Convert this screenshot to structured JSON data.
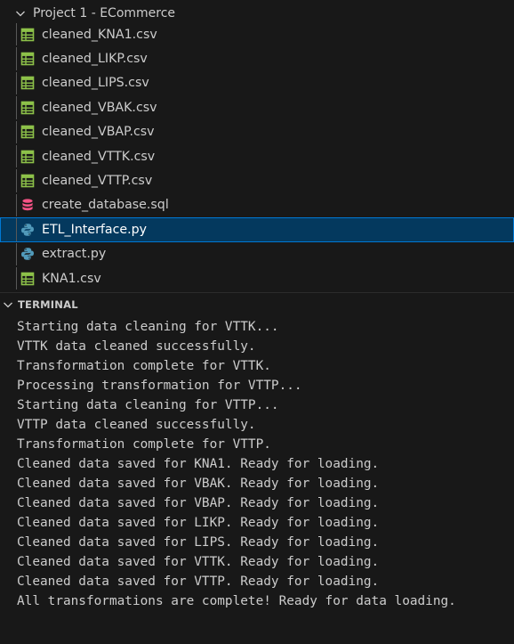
{
  "explorer": {
    "project_title": "Project 1 - ECommerce",
    "files": [
      {
        "name": "cleaned_KNA1.csv",
        "icon": "csv-icon",
        "selected": false
      },
      {
        "name": "cleaned_LIKP.csv",
        "icon": "csv-icon",
        "selected": false
      },
      {
        "name": "cleaned_LIPS.csv",
        "icon": "csv-icon",
        "selected": false
      },
      {
        "name": "cleaned_VBAK.csv",
        "icon": "csv-icon",
        "selected": false
      },
      {
        "name": "cleaned_VBAP.csv",
        "icon": "csv-icon",
        "selected": false
      },
      {
        "name": "cleaned_VTTK.csv",
        "icon": "csv-icon",
        "selected": false
      },
      {
        "name": "cleaned_VTTP.csv",
        "icon": "csv-icon",
        "selected": false
      },
      {
        "name": "create_database.sql",
        "icon": "database-icon",
        "selected": false
      },
      {
        "name": "ETL_Interface.py",
        "icon": "python-icon",
        "selected": true
      },
      {
        "name": "extract.py",
        "icon": "python-icon",
        "selected": false
      },
      {
        "name": "KNA1.csv",
        "icon": "csv-icon",
        "selected": false
      }
    ]
  },
  "terminal": {
    "title": "TERMINAL",
    "lines": [
      "Starting data cleaning for VTTK...",
      "VTTK data cleaned successfully.",
      "Transformation complete for VTTK.",
      "Processing transformation for VTTP...",
      "Starting data cleaning for VTTP...",
      "VTTP data cleaned successfully.",
      "Transformation complete for VTTP.",
      "Cleaned data saved for KNA1. Ready for loading.",
      "Cleaned data saved for VBAK. Ready for loading.",
      "Cleaned data saved for VBAP. Ready for loading.",
      "Cleaned data saved for LIKP. Ready for loading.",
      "Cleaned data saved for LIPS. Ready for loading.",
      "Cleaned data saved for VTTK. Ready for loading.",
      "Cleaned data saved for VTTP. Ready for loading.",
      "All transformations are complete! Ready for data loading."
    ]
  },
  "colors": {
    "background": "#181818",
    "text": "#cccccc",
    "selection_bg": "#04395e",
    "selection_border": "#0078d4",
    "csv_icon": "#8dc149",
    "database_icon": "#f55385",
    "python_icon": "#519aba"
  }
}
